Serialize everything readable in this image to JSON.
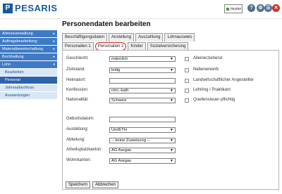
{
  "header": {
    "logo_mark": "P",
    "logo_text": "PESARIS",
    "user_label": "muster",
    "icons": [
      "help-icon",
      "settings-icon",
      "users-icon",
      "close-icon"
    ],
    "icon_glyphs": {
      "help": "?",
      "settings": "⚙",
      "users": "☰",
      "close": "✕"
    }
  },
  "sidebar": {
    "items": [
      {
        "label": "Adressverwaltung",
        "arrow": "▸"
      },
      {
        "label": "Auftragsbearbeitung",
        "arrow": "▸"
      },
      {
        "label": "Materialbewirtschaftung",
        "arrow": "▸"
      },
      {
        "label": "Buchhaltung",
        "arrow": "▸"
      },
      {
        "label": "Lohn",
        "arrow": "▾"
      }
    ],
    "subitems": [
      {
        "label": "Bearbeiten",
        "active": false
      },
      {
        "label": "Personal",
        "active": true
      },
      {
        "label": "Jahresabschluss",
        "active": false
      },
      {
        "label": "Auswertungen",
        "active": false
      }
    ]
  },
  "page_title": "Personendaten bearbeiten",
  "tabs_row1": [
    "Beschäftigungsdaten",
    "Anstellung",
    "Auszahlung",
    "Lohnausweis"
  ],
  "tabs_row2": [
    "Personalien 1",
    "Personalien 2",
    "Kinder",
    "Sozialversicherung"
  ],
  "selected_tab": "Personalien 2",
  "form": {
    "geschlecht": {
      "label": "Geschlecht:",
      "value": "männlich"
    },
    "zivilstand": {
      "label": "Zivilstand:",
      "value": "ledig"
    },
    "heimatort": {
      "label": "Heimatort:",
      "value": ""
    },
    "konfession": {
      "label": "Konfession:",
      "value": "röm.-kath"
    },
    "nationalitaet": {
      "label": "Nationalität:",
      "value": "Schweiz"
    },
    "geburtsdatum": {
      "label": "Geburtsdatum:",
      "value": ""
    },
    "ausbildung": {
      "label": "Ausbildung:",
      "value": "Uni/ETH"
    },
    "abteilung": {
      "label": "Abteilung:",
      "value": "-- keine Zuweisung --"
    },
    "arbeitsplatzkanton": {
      "label": "Arbeitsplatzkanton:",
      "value": "AG Aargau"
    },
    "wohnkanton": {
      "label": "Wohnkanton:",
      "value": "AG Aargau"
    }
  },
  "checkboxes": [
    {
      "label": "Alleinerziehend",
      "checked": false
    },
    {
      "label": "Nebenerwerb",
      "checked": false
    },
    {
      "label": "Landwirtschaftlicher Angestellter",
      "checked": false
    },
    {
      "label": "Lehrling / Praktikant",
      "checked": false
    },
    {
      "label": "Quellensteuer pflichtig",
      "checked": false
    }
  ],
  "dropdown_glyph": "▼",
  "buttons": {
    "save": "Speichern",
    "cancel": "Abbrechen"
  },
  "colors": {
    "brand": "#1a5b98",
    "nav": "#3f7ac5",
    "nav_active": "#2c63ad",
    "tab_highlight": "#d9251d"
  }
}
